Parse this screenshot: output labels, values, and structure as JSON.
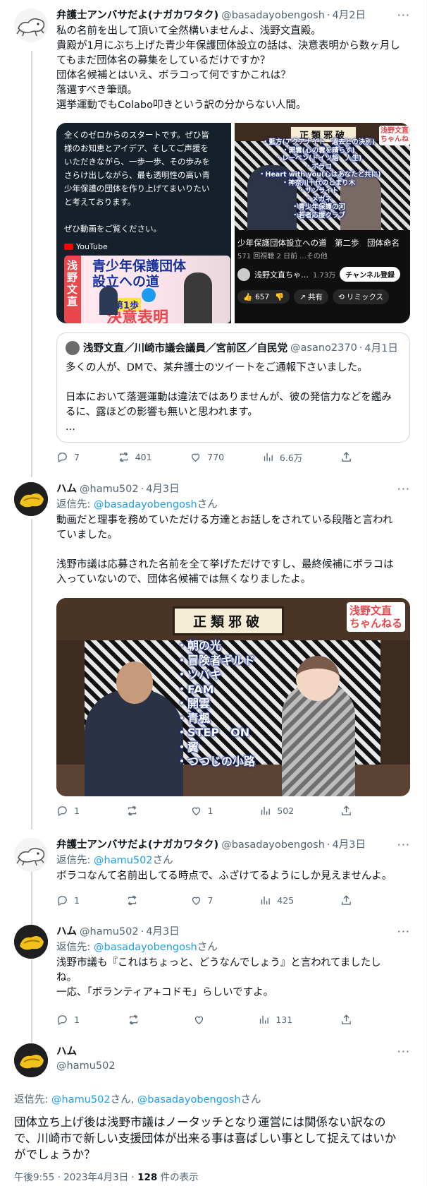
{
  "tweets": [
    {
      "name": "弁護士アンバサだよ(ナガカワタク)",
      "handle": "@basadayobengosh",
      "date": "4月2日",
      "text": "私の名前を出して頂いて全然構いませんよ、浅野文直殿。\n貴殿が1月にぶち上げた青少年保護団体設立の話は、決意表明から数ヶ月し\nてもまだ団体名の募集をしているだけですか？\n団体名候補とはいえ、ボラコって何ですかこれは？\n落選すべき筆頭。\n選挙運動でもColabo叩きという訳の分からない人間。",
      "media_left": {
        "text": "全くのゼロからのスタートです。ぜひ皆\n様のお知恵とアイデア、そしてご声援を\nいただきながら、一歩一歩、その歩みを\nさらけ出しながら、最も透明性の高い青\n少年保護の団体を作り上げてまいりたい\nと考えております。\n\nぜひ動画をご覧ください。",
        "youtube_label": "YouTube",
        "thumb_side": "浅野文直",
        "thumb_title": "青少年保護団体\n設立への道",
        "thumb_step": "第1歩",
        "thumb_bottom": "決意表明"
      },
      "media_right": {
        "board": "正類邪破",
        "channel_badge": "浅野文直\nちゃんね",
        "list": "・藍方(アクアナイト　過去との決別)\n・開雲(心の雲を晴らす)\n・レーベン(ドイツ語　人生)\n・ボラコ\n・Heart with you(心はあなたと共に)\n・神奈川十代のとまり木\n・サンライト\n・メガネ\n・青少年保護の河\n・若者応援クラブ",
        "video_title": "少年保護団体設立への道　第二歩　団体命名",
        "views": "571 回視聴  2 日前  ...その他",
        "channel_name": "浅野文直ちゃ…",
        "subs": "1.73万",
        "subscribe": "チャンネル登録",
        "likes": "657",
        "share": "共有",
        "remix": "リミックス"
      },
      "quote": {
        "name": "浅野文直／川崎市議会議員／宮前区／自民党",
        "handle": "@asano2370",
        "date": "4月1日",
        "text": "多くの人が、DMで、某弁護士のツイートをご通報下さいました。\n\n日本において落選運動は違法ではありませんが、彼の発信力などを鑑み\nるに、露ほどの影響も無いと思われます。\n..."
      },
      "replies": "7",
      "retweets": "401",
      "likes": "770",
      "views": "6.6万"
    },
    {
      "name": "ハム",
      "handle": "@hamu502",
      "date": "4月3日",
      "reply_prefix": "返信先: ",
      "reply_link": "@basadayobengosh",
      "reply_suffix": "さん",
      "text": "動画だと理事を務めていただける方達とお話しをされている段階と言われ\nていました。\n\n浅野市議は応募された名前を全て挙げただけですし、最終候補にボラコは\n入っていないので、団体名候補では無くなりましたよ。",
      "media": {
        "board": "正類邪破",
        "channel_badge": "浅野文直\nちゃんねる",
        "list": "・朝の光\n・冒険者ギルド\n・ツバキ\n・FAM\n・開雲\n・青楓\n・STEP　ON\n・翼\n・つつじの小路"
      },
      "replies": "1",
      "retweets": "",
      "likes": "1",
      "views": "502"
    },
    {
      "name": "弁護士アンバサだよ(ナガカワタク)",
      "handle": "@basadayobengosh",
      "date": "4月3日",
      "reply_prefix": "返信先: ",
      "reply_link": "@hamu502",
      "reply_suffix": "さん",
      "text": "ボラコなんて名前出してる時点で、ふざけてるようにしか見えませんよ。",
      "replies": "1",
      "retweets": "",
      "likes": "7",
      "views": "425"
    },
    {
      "name": "ハム",
      "handle": "@hamu502",
      "date": "4月3日",
      "reply_prefix": "返信先: ",
      "reply_link": "@basadayobengosh",
      "reply_suffix": "さん",
      "text": "浅野市議も『これはちょっと、どうなんでしょう』と言われてましたし\nね。\n一応、「ボランティア+コドモ」らしいですよ。",
      "replies": "1",
      "retweets": "",
      "likes": "",
      "views": "131"
    }
  ],
  "focus": {
    "name": "ハム",
    "handle": "@hamu502",
    "reply_prefix": "返信先: ",
    "reply_link1": "@hamu502",
    "reply_mid": "さん, ",
    "reply_link2": "@basadayobengosh",
    "reply_suffix": "さん",
    "text": "団体立ち上げ後は浅野市議はノータッチとなり運営には関係ない訳なの\nで、川崎市で新しい支援団体が出来る事は喜ばしい事として捉えてはいか\nがでしょうか？",
    "time": "午後9:55 · 2023年4月3日 · ",
    "view_count": "128",
    "view_label": " 件の表示"
  },
  "more_label": "···",
  "colors": {
    "link": "#1d9bf0",
    "secondary": "#536471",
    "border": "#cfd9de"
  }
}
